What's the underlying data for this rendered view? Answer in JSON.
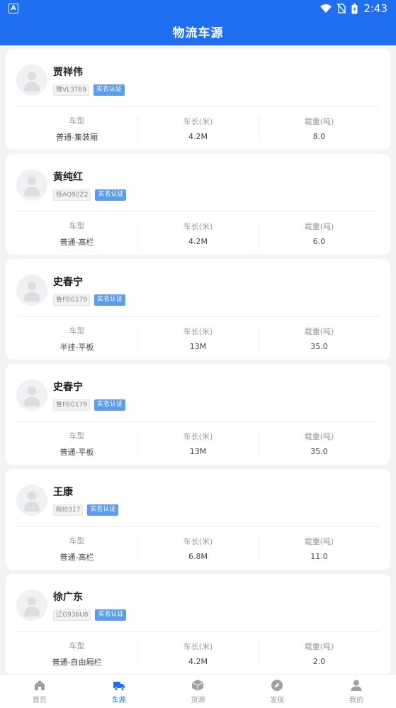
{
  "status": {
    "time": "2:43"
  },
  "header": {
    "title": "物流车源"
  },
  "labels": {
    "type": "车型",
    "length": "车长(米)",
    "load": "载重(吨)"
  },
  "vehicles": [
    {
      "name": "贾祥伟",
      "plate": "豫VL3T69",
      "badge": "实名认证",
      "type": "普通-集装厢",
      "length": "4.2M",
      "load": "8.0"
    },
    {
      "name": "黄纯红",
      "plate": "桂AQ92Z2",
      "badge": "实名认证",
      "type": "普通-高栏",
      "length": "4.2M",
      "load": "6.0"
    },
    {
      "name": "史春宁",
      "plate": "鲁FEG179",
      "badge": "实名认证",
      "type": "半挂-平板",
      "length": "13M",
      "load": "35.0"
    },
    {
      "name": "史春宁",
      "plate": "鲁FEG179",
      "badge": "实名认证",
      "type": "普通-平板",
      "length": "13M",
      "load": "35.0"
    },
    {
      "name": "王康",
      "plate": "皖l0317",
      "badge": "实名认证",
      "type": "普通-高栏",
      "length": "6.8M",
      "load": "11.0"
    },
    {
      "name": "徐广东",
      "plate": "辽G936U8",
      "badge": "实名认证",
      "type": "普通-自由厢栏",
      "length": "4.2M",
      "load": "2.0"
    }
  ],
  "tabs": [
    {
      "label": "首页",
      "icon": "home-icon"
    },
    {
      "label": "车源",
      "icon": "truck-icon",
      "active": true
    },
    {
      "label": "货源",
      "icon": "cargo-box-icon"
    },
    {
      "label": "发现",
      "icon": "compass-icon"
    },
    {
      "label": "我的",
      "icon": "person-icon"
    }
  ],
  "colors": {
    "brand": "#1f6ff0",
    "badge": "#5b9cf0"
  }
}
